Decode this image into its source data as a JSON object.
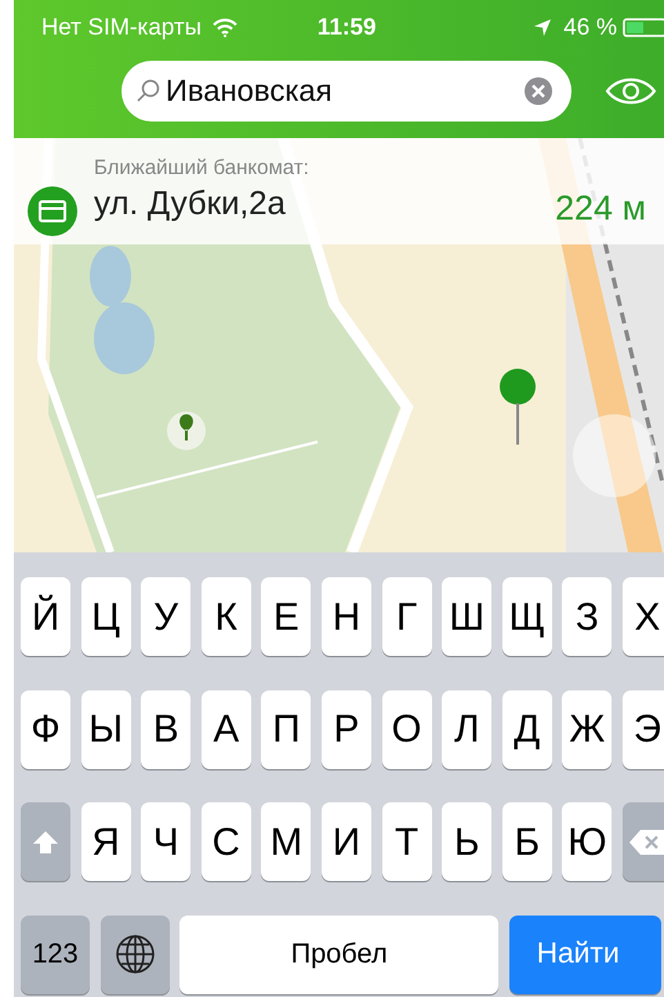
{
  "status_bar": {
    "carrier": "Нет SIM-карты",
    "time": "11:59",
    "battery": "46 %"
  },
  "search": {
    "value": "Ивановская"
  },
  "nearest_atm": {
    "label": "Ближайший банкомат:",
    "address": "ул. Дубки,2а",
    "distance": "224 м"
  },
  "keyboard": {
    "rows": [
      [
        {
          "kind": "letter",
          "label": "Й"
        },
        {
          "kind": "letter",
          "label": "Ц"
        },
        {
          "kind": "letter",
          "label": "У"
        },
        {
          "kind": "letter",
          "label": "К"
        },
        {
          "kind": "letter",
          "label": "Е"
        },
        {
          "kind": "letter",
          "label": "Н"
        },
        {
          "kind": "letter",
          "label": "Г"
        },
        {
          "kind": "letter",
          "label": "Ш"
        },
        {
          "kind": "letter",
          "label": "Щ"
        },
        {
          "kind": "letter",
          "label": "З"
        },
        {
          "kind": "letter",
          "label": "Х"
        }
      ],
      [
        {
          "kind": "letter",
          "label": "Ф"
        },
        {
          "kind": "letter",
          "label": "Ы"
        },
        {
          "kind": "letter",
          "label": "В"
        },
        {
          "kind": "letter",
          "label": "А"
        },
        {
          "kind": "letter",
          "label": "П"
        },
        {
          "kind": "letter",
          "label": "Р"
        },
        {
          "kind": "letter",
          "label": "О"
        },
        {
          "kind": "letter",
          "label": "Л"
        },
        {
          "kind": "letter",
          "label": "Д"
        },
        {
          "kind": "letter",
          "label": "Ж"
        },
        {
          "kind": "letter",
          "label": "Э"
        }
      ],
      [
        {
          "kind": "shift"
        },
        {
          "kind": "letter",
          "label": "Я"
        },
        {
          "kind": "letter",
          "label": "Ч"
        },
        {
          "kind": "letter",
          "label": "С"
        },
        {
          "kind": "letter",
          "label": "М"
        },
        {
          "kind": "letter",
          "label": "И"
        },
        {
          "kind": "letter",
          "label": "Т"
        },
        {
          "kind": "letter",
          "label": "Ь"
        },
        {
          "kind": "letter",
          "label": "Б"
        },
        {
          "kind": "letter",
          "label": "Ю"
        },
        {
          "kind": "backspace"
        }
      ]
    ],
    "bottom_bar": [
      {
        "kind": "numbers",
        "label": "123"
      },
      {
        "kind": "globe"
      },
      {
        "kind": "space",
        "label": "Пробел"
      },
      {
        "kind": "action",
        "label": "Найти"
      }
    ]
  }
}
